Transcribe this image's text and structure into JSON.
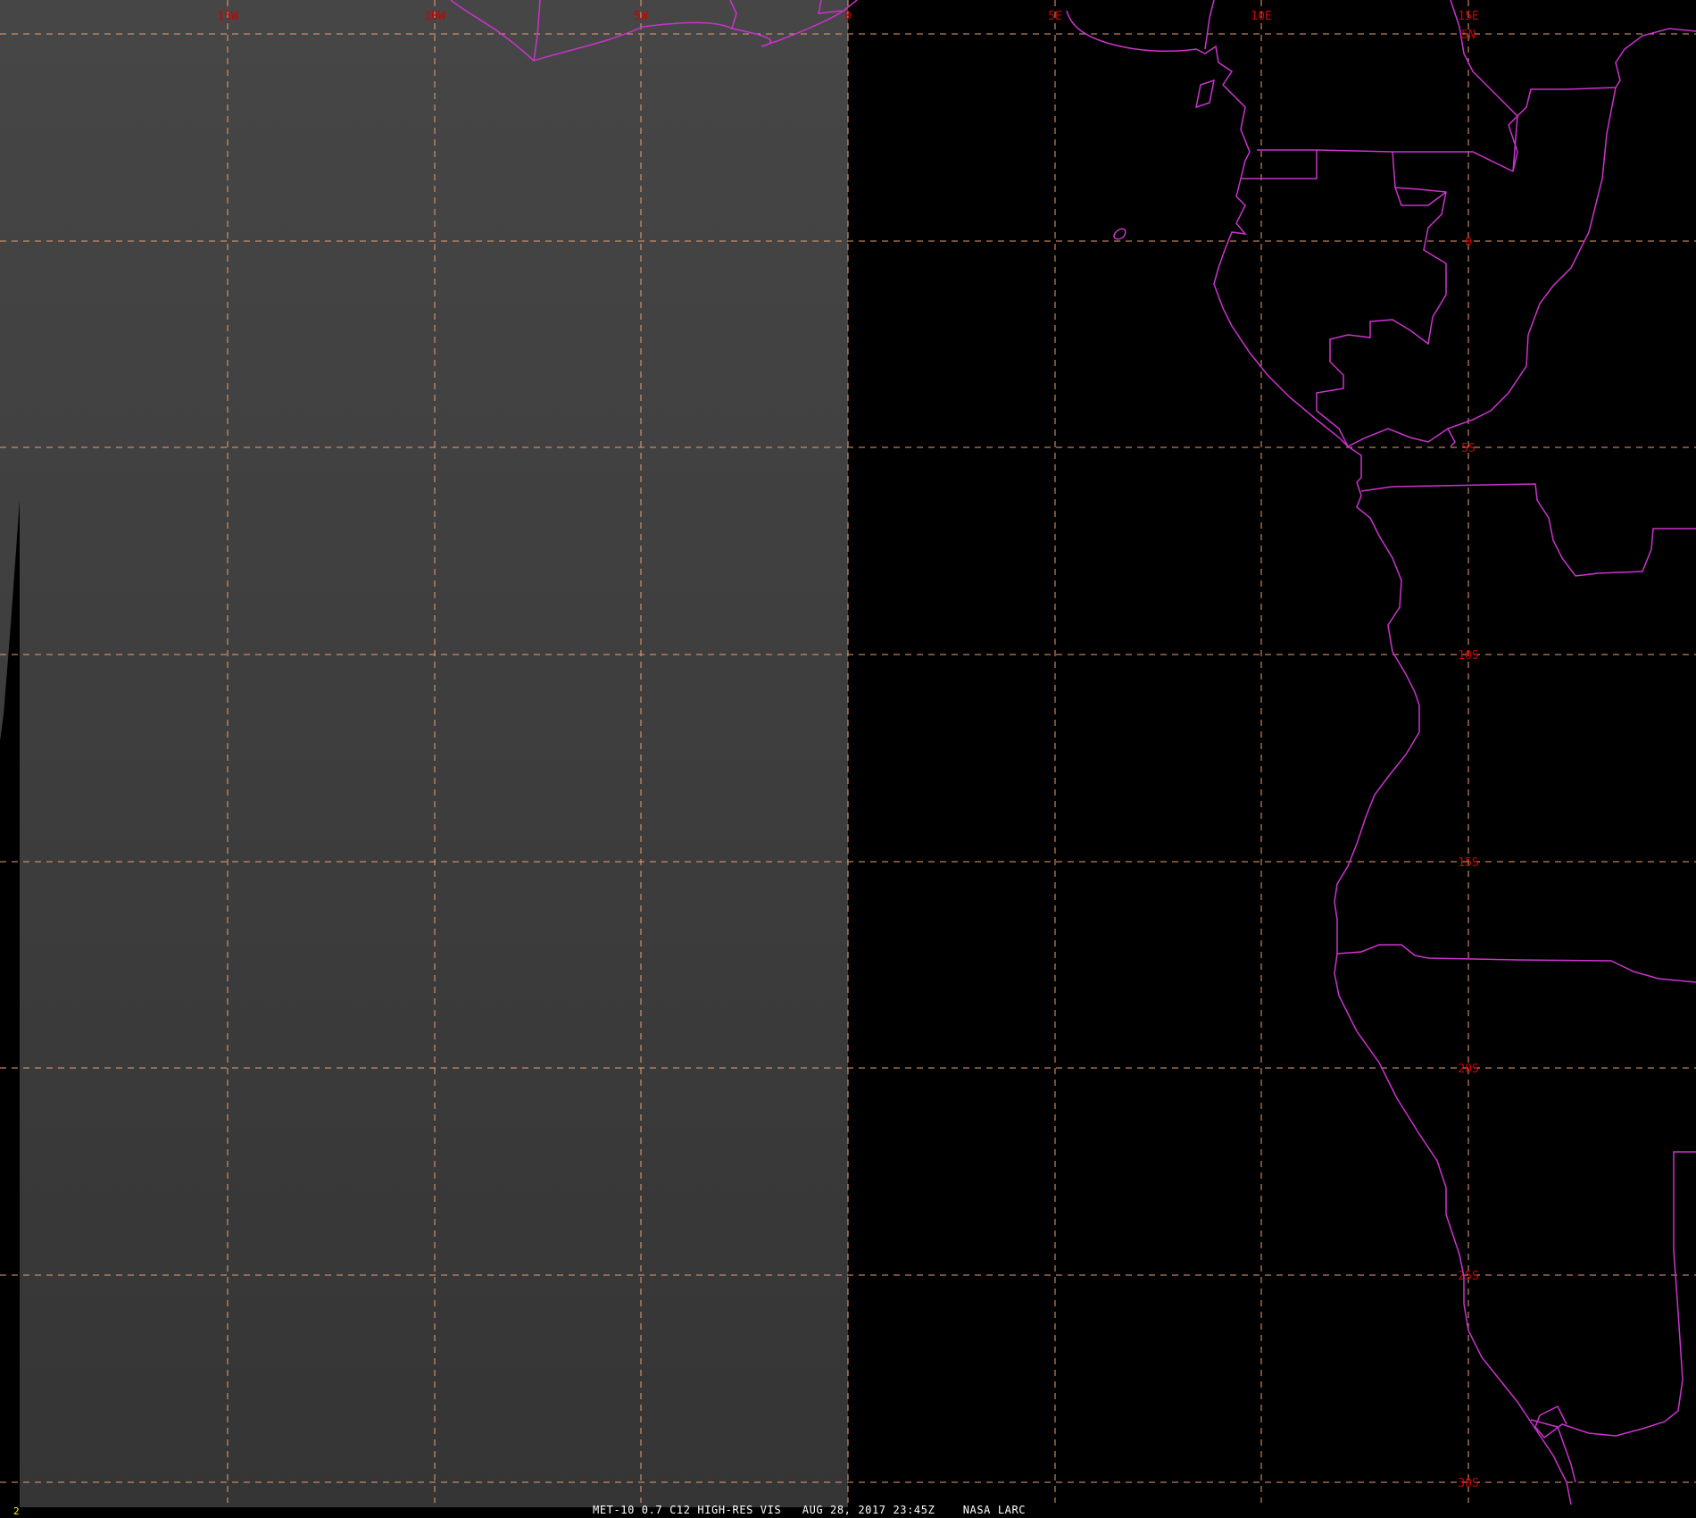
{
  "image": {
    "satellite": "MET-10",
    "band": "0.7",
    "channel": "C12",
    "product": "HIGH-RES VIS",
    "date": "AUG 28, 2017",
    "time": "23:45Z",
    "credit": "NASA LARC",
    "caption": "MET-10 0.7 C12 HIGH-RES VIS   AUG 28, 2017 23:45Z    NASA LARC",
    "frame_number": "2"
  },
  "grid": {
    "longitude_labels": [
      "15W",
      "10W",
      "5W",
      "0",
      "5E",
      "10E",
      "15E"
    ],
    "latitude_labels": [
      "5N",
      "0",
      "5S",
      "10S",
      "15S",
      "20S",
      "25S",
      "30S"
    ],
    "style": "dashed"
  },
  "overlays": {
    "coastlines_and_borders": "magenta",
    "day_night_terminator": "0"
  },
  "colors": {
    "background": "#000000",
    "daylight_region": "#404040",
    "grid_lines": "#e8a070",
    "grid_labels": "#cc0000",
    "boundaries": "#cc33cc",
    "caption_text": "#ffffff",
    "frame_number": "#ffff00"
  },
  "icons": {
    "map": "satellite-map-icon"
  }
}
